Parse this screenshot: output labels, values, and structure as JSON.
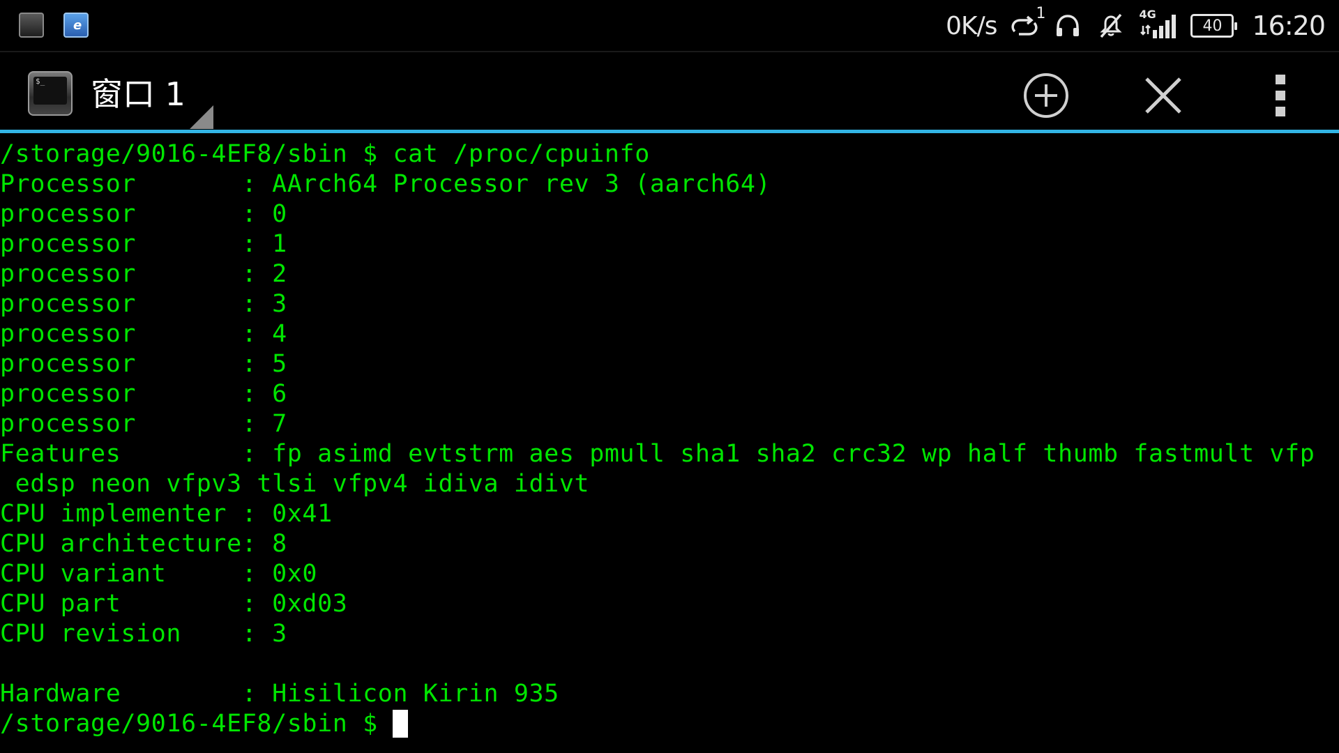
{
  "status_bar": {
    "net_speed": "0K/s",
    "sim_badge": "1",
    "network_type": "4G",
    "battery_level": "40",
    "time": "16:20",
    "icons": [
      "terminal-notification-icon",
      "browser-notification-icon",
      "data-roaming-icon",
      "headphones-icon",
      "mute-icon",
      "signal-icon",
      "battery-icon"
    ]
  },
  "action_bar": {
    "window_title": "窗口 1",
    "new_window_icon": "plus-circle-icon",
    "close_window_icon": "close-icon",
    "overflow_icon": "more-vert-icon",
    "accent_color": "#33b5e5"
  },
  "terminal": {
    "text_color": "#00e600",
    "lines": [
      "/storage/9016-4EF8/sbin $ cat /proc/cpuinfo",
      "Processor       : AArch64 Processor rev 3 (aarch64)",
      "processor       : 0",
      "processor       : 1",
      "processor       : 2",
      "processor       : 3",
      "processor       : 4",
      "processor       : 5",
      "processor       : 6",
      "processor       : 7",
      "Features        : fp asimd evtstrm aes pmull sha1 sha2 crc32 wp half thumb fastmult vfp",
      " edsp neon vfpv3 tlsi vfpv4 idiva idivt",
      "CPU implementer : 0x41",
      "CPU architecture: 8",
      "CPU variant     : 0x0",
      "CPU part        : 0xd03",
      "CPU revision    : 3",
      "",
      "Hardware        : Hisilicon Kirin 935"
    ],
    "prompt": "/storage/9016-4EF8/sbin $ "
  }
}
